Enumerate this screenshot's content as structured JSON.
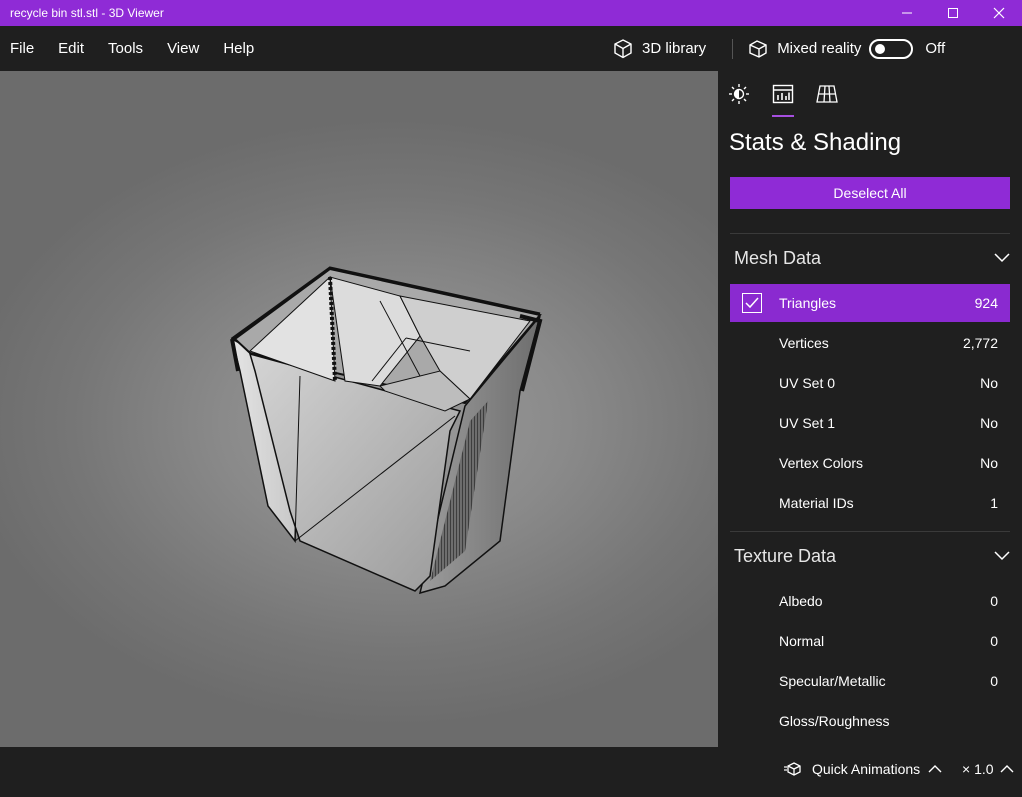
{
  "window": {
    "title": "recycle bin stl.stl - 3D Viewer"
  },
  "menu": {
    "items": [
      "File",
      "Edit",
      "Tools",
      "View",
      "Help"
    ]
  },
  "toolbar": {
    "library_label": "3D library",
    "mixed_reality_label": "Mixed reality",
    "toggle_state": "Off"
  },
  "panel": {
    "title": "Stats & Shading",
    "deselect_label": "Deselect All",
    "mesh_data": {
      "header": "Mesh Data",
      "rows": [
        {
          "label": "Triangles",
          "value": "924"
        },
        {
          "label": "Vertices",
          "value": "2,772"
        },
        {
          "label": "UV Set 0",
          "value": "No"
        },
        {
          "label": "UV Set 1",
          "value": "No"
        },
        {
          "label": "Vertex Colors",
          "value": "No"
        },
        {
          "label": "Material IDs",
          "value": "1"
        }
      ]
    },
    "texture_data": {
      "header": "Texture Data",
      "rows": [
        {
          "label": "Albedo",
          "value": "0"
        },
        {
          "label": "Normal",
          "value": "0"
        },
        {
          "label": "Specular/Metallic",
          "value": "0"
        },
        {
          "label": "Gloss/Roughness",
          "value": ""
        }
      ]
    }
  },
  "bottom": {
    "animations_label": "Quick Animations",
    "speed_label": "× 1.0"
  },
  "colors": {
    "accent": "#8f2bd6",
    "background": "#1f1f1f",
    "viewport": "#8a8a8a"
  }
}
